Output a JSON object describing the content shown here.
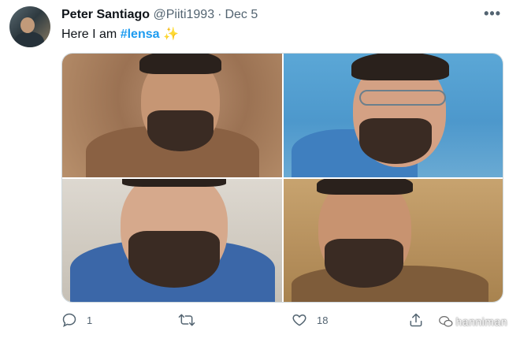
{
  "tweet": {
    "display_name": "Peter Santiago",
    "handle": "@Piiti1993",
    "separator": "·",
    "date": "Dec 5",
    "more_label": "•••",
    "text_prefix": "Here I am",
    "hashtag": "#lensa",
    "emoji": "✨"
  },
  "media": {
    "photos": [
      {
        "label": "portrait-photo-1"
      },
      {
        "label": "portrait-photo-2"
      },
      {
        "label": "portrait-photo-3"
      },
      {
        "label": "portrait-photo-4"
      }
    ]
  },
  "actions": {
    "reply_count": "1",
    "retweet_count": "",
    "like_count": "18"
  },
  "watermark": {
    "text": "hanniman"
  },
  "colors": {
    "text_primary": "#0f1419",
    "text_secondary": "#536471",
    "link": "#1d9bf0",
    "border": "#cfd9de"
  }
}
